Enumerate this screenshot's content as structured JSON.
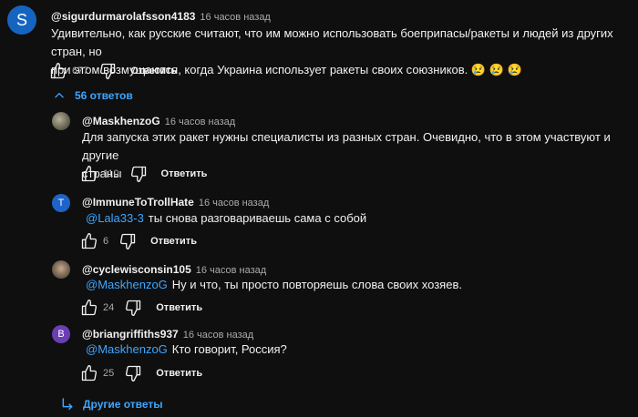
{
  "top_comment": {
    "avatar_letter": "S",
    "avatar_color": "#1565c0",
    "author": "@sigurdurmarolafsson4183",
    "time": "16 часов назад",
    "line1": "Удивительно, как русские считают, что им можно использовать боеприпасы/ракеты и людей из других стран, но",
    "line2": "при этом возмущаются, когда Украина использует ракеты своих союзников. 😢 😢 😢",
    "likes": "677",
    "reply_label": "Ответить"
  },
  "replies_toggle": {
    "label": "56 ответов"
  },
  "replies": [
    {
      "author": "@MaskhenzoG",
      "time": "16 часов назад",
      "avatar_type": "photo",
      "line1": "Для запуска этих ракет нужны специалисты из разных стран. Очевидно, что в этом участвуют и другие",
      "line2": "страны",
      "likes": "110",
      "reply_label": "Ответить"
    },
    {
      "author": "@ImmuneToTrollHate",
      "time": "16 часов назад",
      "avatar_type": "letter",
      "avatar_letter": "T",
      "avatar_color": "#1e63c8",
      "mention": "@Lala33-3",
      "text": "ты снова разговариваешь сама с собой",
      "likes": "6",
      "reply_label": "Ответить"
    },
    {
      "author": "@cyclewisconsin105",
      "time": "16 часов назад",
      "avatar_type": "photo",
      "mention": "@MaskhenzoG",
      "text": "Ну и что, ты просто повторяешь слова своих хозяев.",
      "likes": "24",
      "reply_label": "Ответить"
    },
    {
      "author": "@briangriffiths937",
      "time": "16 часов назад",
      "avatar_type": "letter",
      "avatar_letter": "B",
      "avatar_color": "#6a3fb5",
      "mention": "@MaskhenzoG",
      "text": "Кто говорит, Россия?",
      "likes": "25",
      "reply_label": "Ответить"
    }
  ],
  "more_replies": {
    "label": "Другие ответы"
  },
  "icons": {
    "like": "thumbs-up-icon",
    "dislike": "thumbs-down-icon",
    "expand": "chevron-up-icon",
    "more": "return-arrow-icon"
  }
}
